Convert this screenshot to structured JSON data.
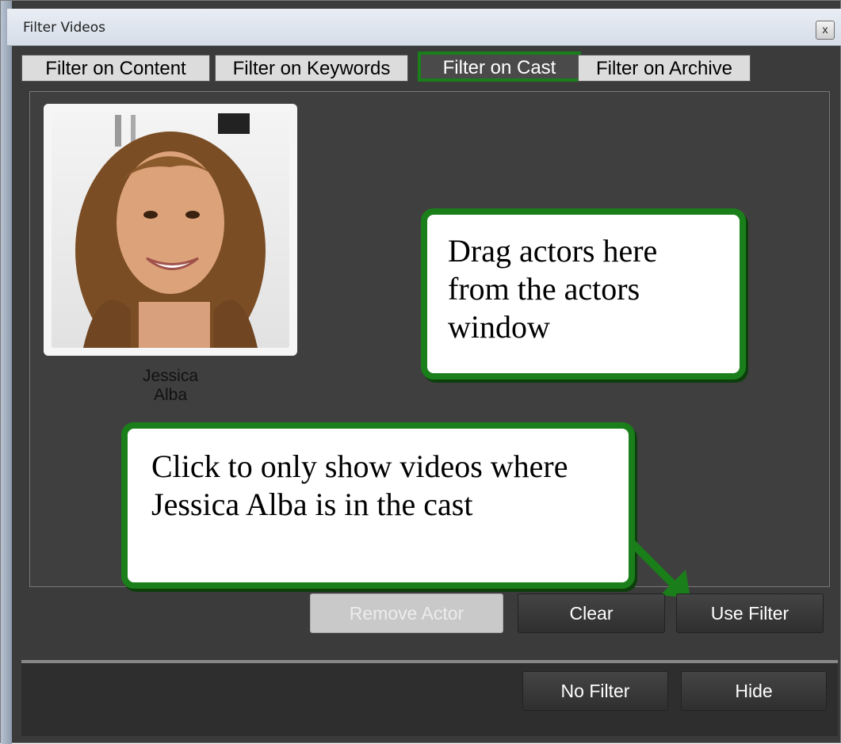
{
  "window": {
    "title": "Filter Videos",
    "close_glyph": "x"
  },
  "tabs": [
    {
      "label": "Filter on Content",
      "active": false
    },
    {
      "label": "Filter on Keywords",
      "active": false
    },
    {
      "label": "Filter on Cast",
      "active": true
    },
    {
      "label": "Filter on Archive",
      "active": false
    }
  ],
  "cast": {
    "actors": [
      {
        "name_line1": "Jessica",
        "name_line2": "Alba"
      }
    ]
  },
  "annotations": {
    "drag_hint": "Drag actors here from the actors window",
    "click_hint": "Click to only show videos where Jessica Alba is in the cast"
  },
  "actions": {
    "remove_actor": "Remove Actor",
    "clear": "Clear",
    "use_filter": "Use Filter"
  },
  "footer": {
    "no_filter": "No Filter",
    "hide": "Hide"
  },
  "colors": {
    "annotation_green": "#1a7f1a",
    "panel_dark": "#3b3b3b"
  }
}
